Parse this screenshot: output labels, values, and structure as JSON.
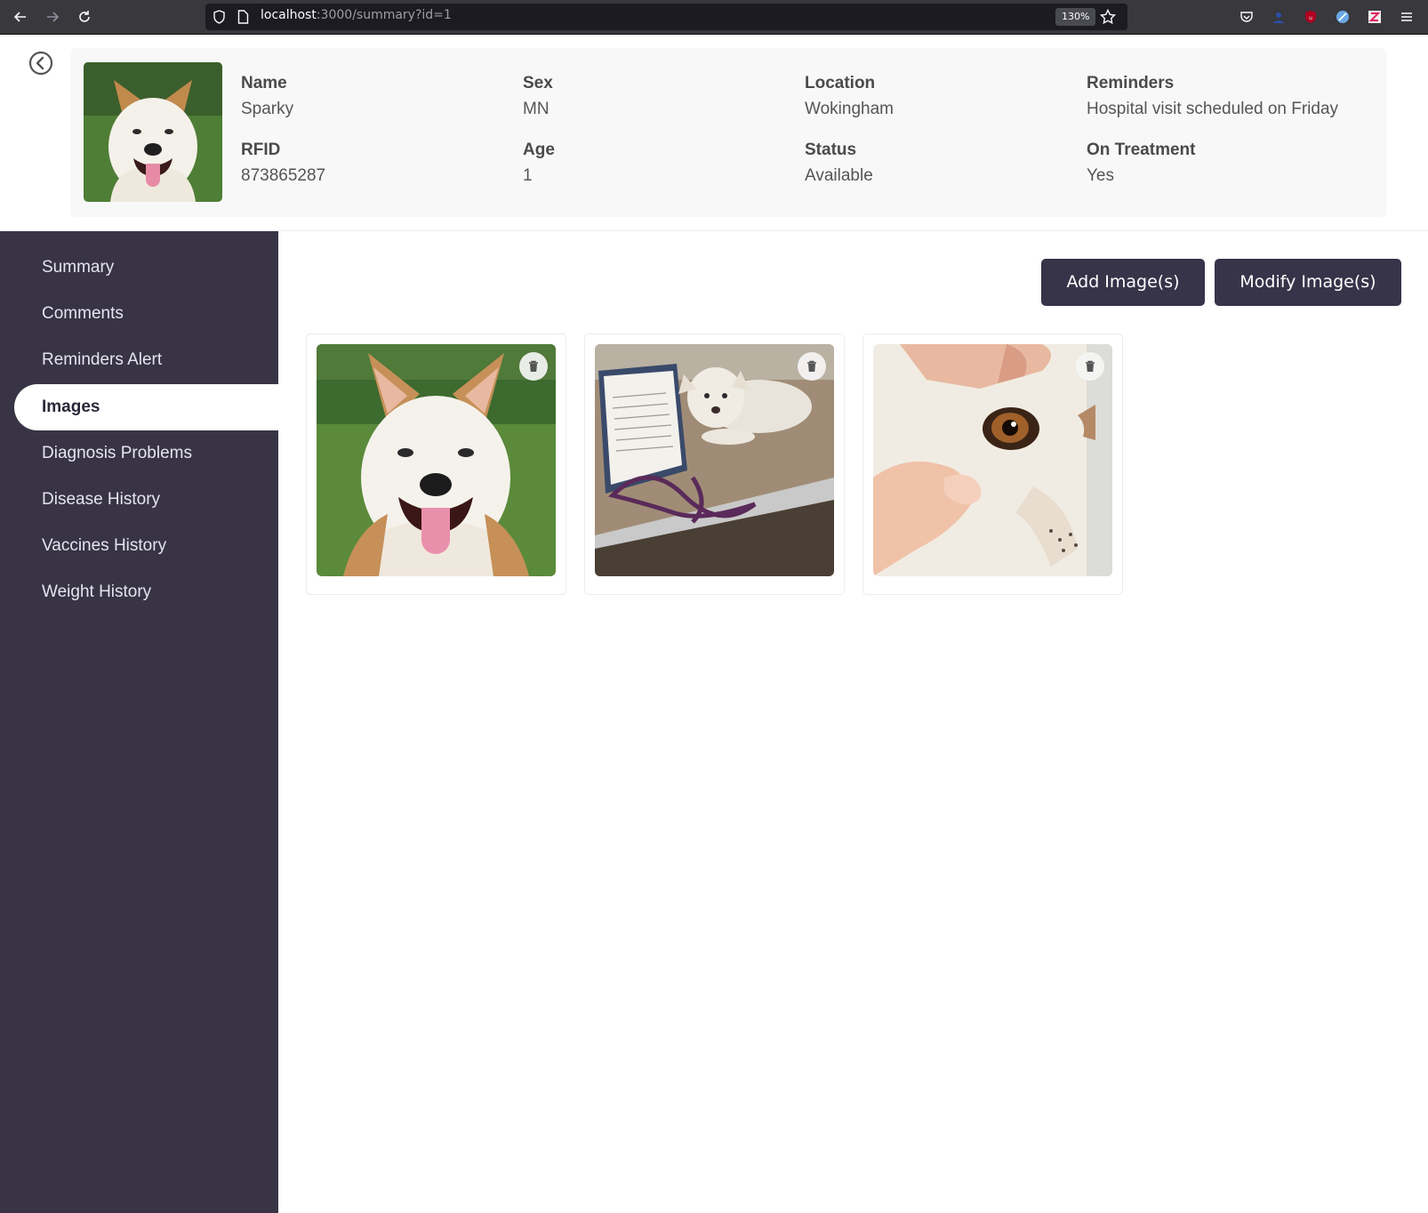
{
  "browser": {
    "url_host": "localhost",
    "url_path": ":3000/summary?id=1",
    "zoom": "130%"
  },
  "colors": {
    "sidebar_bg": "#383446",
    "button_bg": "#373349",
    "header_card_bg": "#f8f8f8"
  },
  "pet": {
    "fields": [
      {
        "label": "Name",
        "value": "Sparky"
      },
      {
        "label": "Sex",
        "value": "MN"
      },
      {
        "label": "Location",
        "value": "Wokingham"
      },
      {
        "label": "Reminders",
        "value": "Hospital visit scheduled on Friday"
      },
      {
        "label": "RFID",
        "value": "873865287"
      },
      {
        "label": "Age",
        "value": "1"
      },
      {
        "label": "Status",
        "value": "Available"
      },
      {
        "label": "On Treatment",
        "value": "Yes"
      }
    ]
  },
  "sidebar": {
    "items": [
      {
        "label": "Summary",
        "active": false
      },
      {
        "label": "Comments",
        "active": false
      },
      {
        "label": "Reminders Alert",
        "active": false
      },
      {
        "label": "Images",
        "active": true
      },
      {
        "label": "Diagnosis Problems",
        "active": false
      },
      {
        "label": "Disease History",
        "active": false
      },
      {
        "label": "Vaccines History",
        "active": false
      },
      {
        "label": "Weight History",
        "active": false
      }
    ]
  },
  "toolbar": {
    "add_label": "Add Image(s)",
    "modify_label": "Modify Image(s)"
  },
  "gallery": {
    "images": [
      {
        "icon": "smiling-dog-photo"
      },
      {
        "icon": "puppy-on-mat-photo"
      },
      {
        "icon": "dog-eye-closeup-photo"
      }
    ]
  }
}
